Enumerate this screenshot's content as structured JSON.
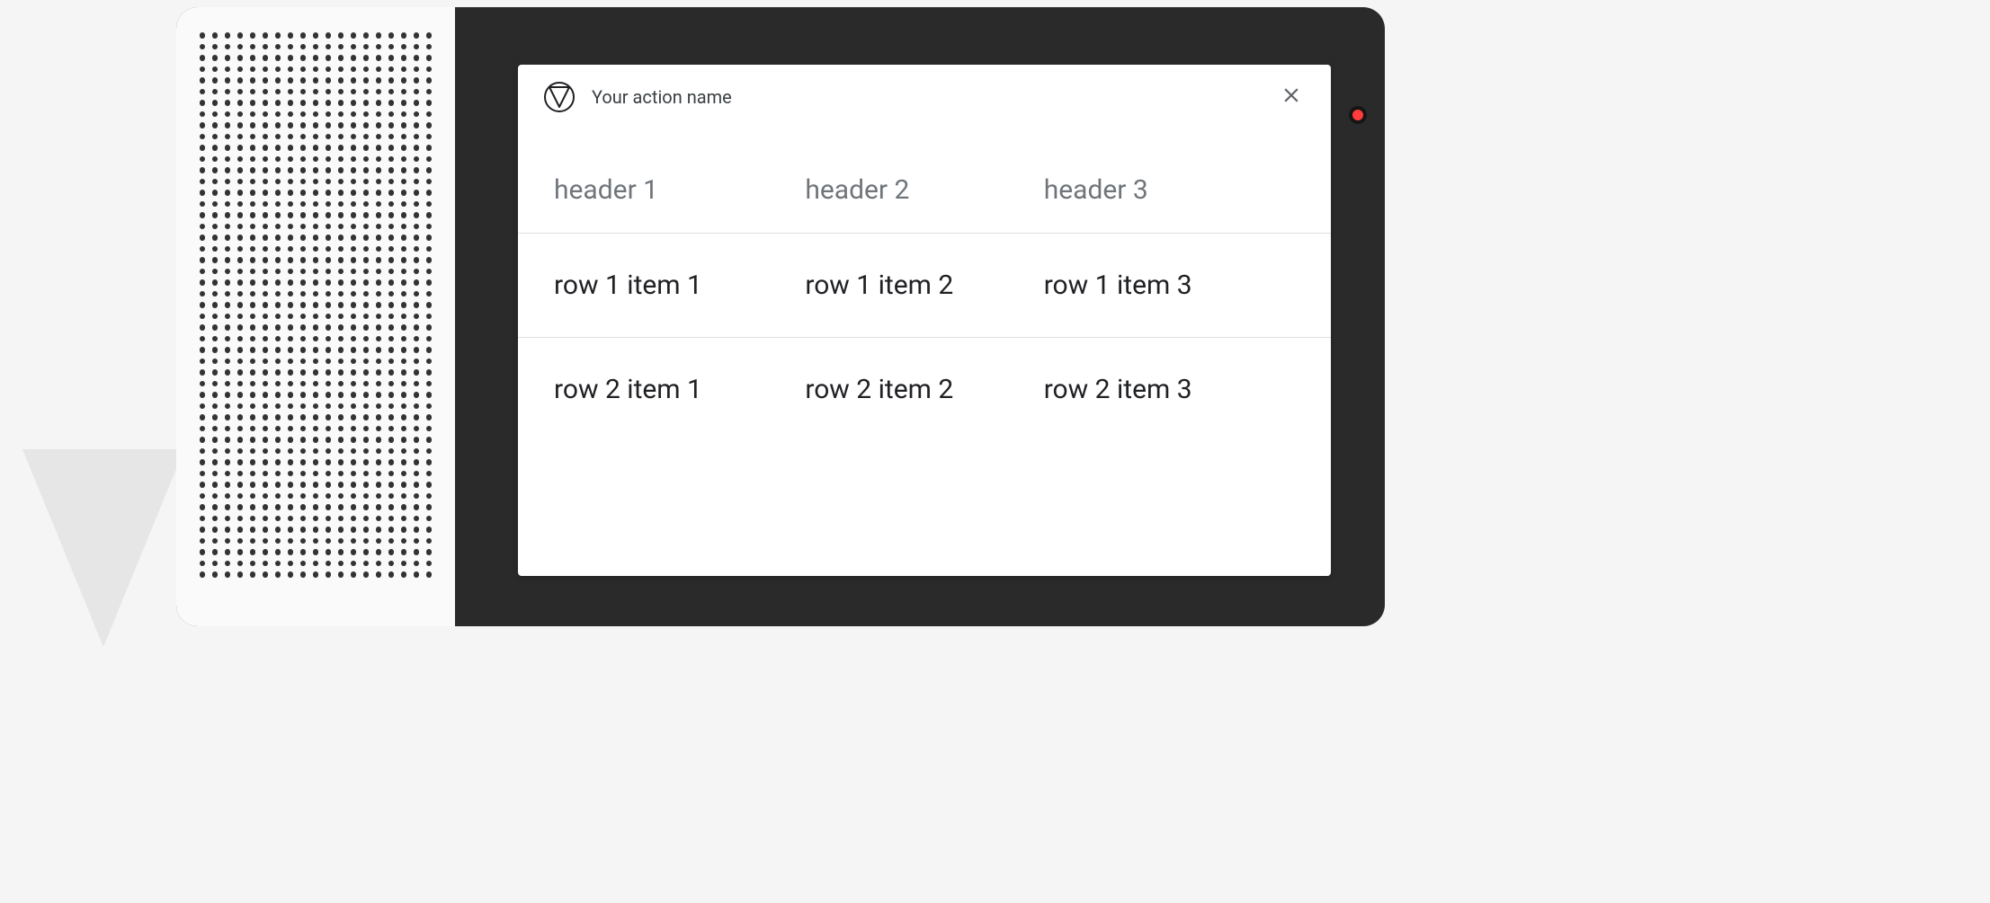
{
  "card": {
    "title": "Your action name"
  },
  "table": {
    "headers": [
      "header 1",
      "header 2",
      "header 3"
    ],
    "rows": [
      [
        "row 1 item 1",
        "row 1 item 2",
        "row 1 item 3"
      ],
      [
        "row 2 item 1",
        "row 2 item 2",
        "row 2 item 3"
      ]
    ]
  }
}
